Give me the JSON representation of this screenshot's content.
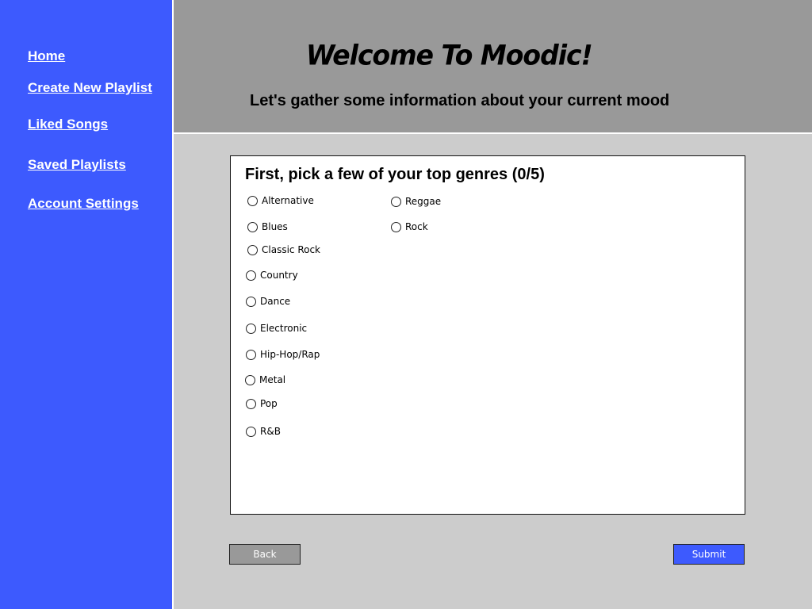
{
  "sidebar": {
    "items": [
      {
        "label": "Home"
      },
      {
        "label": "Create New Playlist"
      },
      {
        "label": "Liked Songs"
      },
      {
        "label": "Saved Playlists"
      },
      {
        "label": "Account Settings"
      }
    ]
  },
  "header": {
    "title": "Welcome To Moodic!",
    "subtitle": "Let's gather some information about your current mood"
  },
  "genre_picker": {
    "title": "First, pick a few of your top genres (0/5)",
    "options": [
      {
        "label": "Alternative",
        "selected": false
      },
      {
        "label": "Blues",
        "selected": false
      },
      {
        "label": "Classic Rock",
        "selected": false
      },
      {
        "label": "Country",
        "selected": false
      },
      {
        "label": "Dance",
        "selected": false
      },
      {
        "label": "Electronic",
        "selected": false
      },
      {
        "label": "Hip-Hop/Rap",
        "selected": false
      },
      {
        "label": "Metal",
        "selected": false
      },
      {
        "label": "Pop",
        "selected": false
      },
      {
        "label": "R&B",
        "selected": false
      },
      {
        "label": "Reggae",
        "selected": false
      },
      {
        "label": "Rock",
        "selected": false
      }
    ]
  },
  "actions": {
    "back_label": "Back",
    "submit_label": "Submit"
  },
  "colors": {
    "sidebar": "#3d5afe",
    "header": "#999999",
    "background": "#cccccc",
    "submit": "#3d5afe",
    "back": "#999999"
  }
}
